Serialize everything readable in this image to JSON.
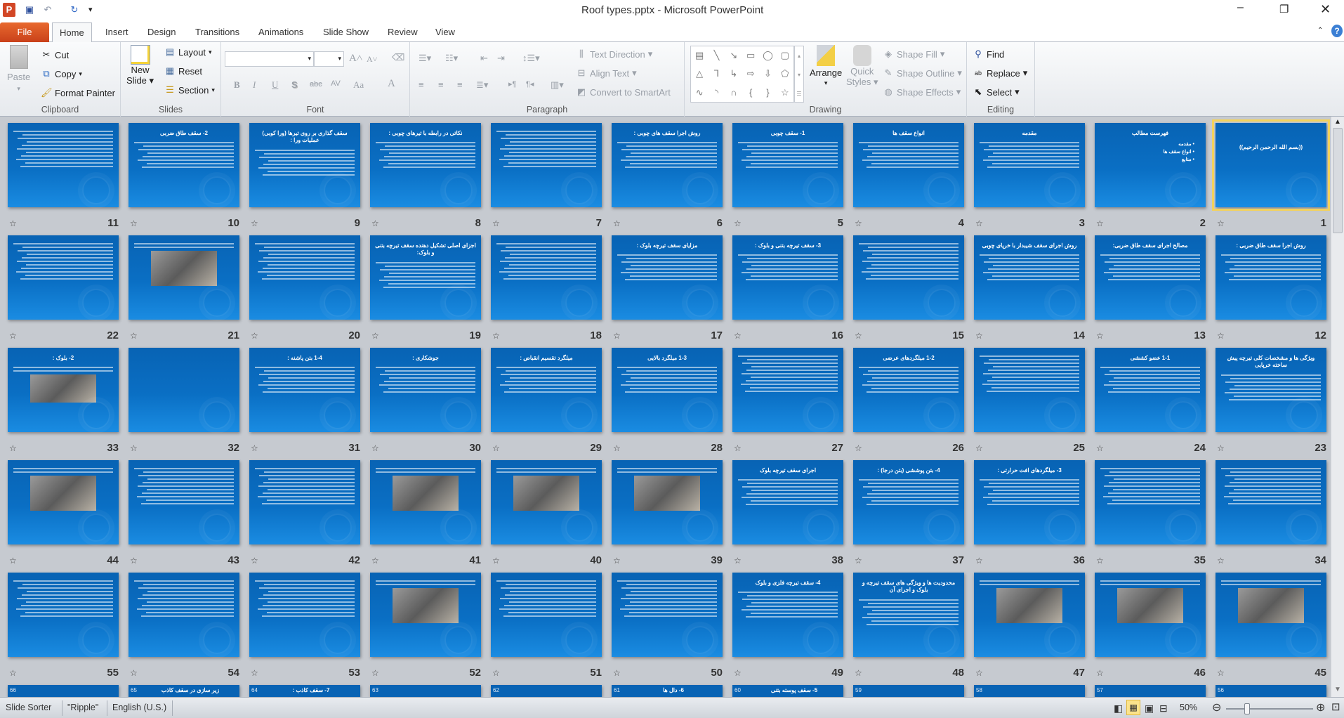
{
  "window": {
    "title": "Roof types.pptx  -  Microsoft PowerPoint",
    "app_icon": "powerpoint-icon"
  },
  "quick_access": {
    "save": "save-icon",
    "undo": "undo-icon",
    "repeat": "repeat-icon",
    "customize": "▾"
  },
  "tabs": [
    {
      "label": "File"
    },
    {
      "label": "Home",
      "active": true
    },
    {
      "label": "Insert"
    },
    {
      "label": "Design"
    },
    {
      "label": "Transitions"
    },
    {
      "label": "Animations"
    },
    {
      "label": "Slide Show"
    },
    {
      "label": "Review"
    },
    {
      "label": "View"
    }
  ],
  "ribbon": {
    "clipboard": {
      "label": "Clipboard",
      "paste": "Paste",
      "cut": "Cut",
      "copy": "Copy",
      "format_painter": "Format Painter"
    },
    "slides": {
      "label": "Slides",
      "new_slide_1": "New",
      "new_slide_2": "Slide",
      "layout": "Layout",
      "reset": "Reset",
      "section": "Section"
    },
    "font": {
      "label": "Font",
      "font_name": "",
      "font_size": "",
      "bold": "B",
      "italic": "I",
      "underline": "U",
      "shadow": "S",
      "strike": "abc",
      "spacing": "AV",
      "case": "Aa",
      "color": "A",
      "grow": "A˄",
      "shrink": "A˅"
    },
    "paragraph": {
      "label": "Paragraph",
      "text_direction": "Text Direction",
      "align_text": "Align Text",
      "smartart": "Convert to SmartArt"
    },
    "drawing": {
      "label": "Drawing",
      "arrange": "Arrange",
      "quick_1": "Quick",
      "quick_2": "Styles",
      "shape_fill": "Shape Fill",
      "shape_outline": "Shape Outline",
      "shape_effects": "Shape Effects",
      "shapes": [
        "▤",
        "╲",
        "↘",
        "▭",
        "◯",
        "▢",
        "△",
        "⅂",
        "↳",
        "⇨",
        "⇩",
        "⬠",
        "∿",
        "◝",
        "∩",
        "{",
        "}",
        "☆"
      ]
    },
    "editing": {
      "label": "Editing",
      "find": "Find",
      "replace": "Replace",
      "select": "Select"
    }
  },
  "slides": [
    {
      "n": "1",
      "title": "((بسم الله الرحمن الرحیم))",
      "kind": "title",
      "selected": true
    },
    {
      "n": "2",
      "title": "فهرست مطالب",
      "kind": "list",
      "items": [
        "مقدمه",
        "انواع سقف ها",
        "منابع"
      ]
    },
    {
      "n": "3",
      "title": "مقدمه",
      "kind": "text"
    },
    {
      "n": "4",
      "title": "انواع سقف ها",
      "kind": "text"
    },
    {
      "n": "5",
      "title": "1- سقف چوبی",
      "kind": "text"
    },
    {
      "n": "6",
      "title": "روش اجرا سقف های چوبی :",
      "kind": "text"
    },
    {
      "n": "7",
      "title": "",
      "kind": "text"
    },
    {
      "n": "8",
      "title": "نکاتی در رابطه با تیرهای چوبی :",
      "kind": "text"
    },
    {
      "n": "9",
      "title": "سقف گذاری بر روی تیرها (ورا کوبی) عملیات ورا :",
      "kind": "text"
    },
    {
      "n": "10",
      "title": "2- سقف طاق ضربی",
      "kind": "text"
    },
    {
      "n": "11",
      "title": "",
      "kind": "text"
    },
    {
      "n": "12",
      "title": "روش اجرا سقف طاق ضربی :",
      "kind": "text"
    },
    {
      "n": "13",
      "title": "مصالح اجرای سقف طاق ضربی:",
      "kind": "text"
    },
    {
      "n": "14",
      "title": "روش اجرای سقف شیبدار با خرپای چوبی",
      "kind": "text"
    },
    {
      "n": "15",
      "title": "",
      "kind": "text"
    },
    {
      "n": "16",
      "title": "3- سقف تیرچه بتنی و بلوک :",
      "kind": "text"
    },
    {
      "n": "17",
      "title": "مزایای سقف تیرچه بلوک :",
      "kind": "text"
    },
    {
      "n": "18",
      "title": "",
      "kind": "text"
    },
    {
      "n": "19",
      "title": "اجزای اصلی تشکیل دهنده سقف تیرچه بتنی و بلوک:",
      "kind": "text"
    },
    {
      "n": "20",
      "title": "",
      "kind": "text"
    },
    {
      "n": "21",
      "title": "",
      "kind": "image"
    },
    {
      "n": "22",
      "title": "",
      "kind": "text"
    },
    {
      "n": "23",
      "title": "ویژگی ها و مشخصات کلی تیرچه پیش ساخته خرپایی",
      "kind": "text"
    },
    {
      "n": "24",
      "title": "1-1  عضو کششی",
      "kind": "text"
    },
    {
      "n": "25",
      "title": "",
      "kind": "text"
    },
    {
      "n": "26",
      "title": "1-2  میلگردهای عرضی",
      "kind": "text"
    },
    {
      "n": "27",
      "title": "",
      "kind": "text"
    },
    {
      "n": "28",
      "title": "1-3  میلگرد بالایی",
      "kind": "text"
    },
    {
      "n": "29",
      "title": "میلگرد تقسیم انقباض :",
      "kind": "text"
    },
    {
      "n": "30",
      "title": "جوشکاری :",
      "kind": "text"
    },
    {
      "n": "31",
      "title": "1-4  بتن پاشنه :",
      "kind": "text"
    },
    {
      "n": "32",
      "title": "",
      "kind": "blank"
    },
    {
      "n": "33",
      "title": "2- بلوک :",
      "kind": "image"
    },
    {
      "n": "34",
      "title": "",
      "kind": "text"
    },
    {
      "n": "35",
      "title": "",
      "kind": "text"
    },
    {
      "n": "36",
      "title": "3- میلگردهای افت حرارتی :",
      "kind": "text"
    },
    {
      "n": "37",
      "title": "4- بتن پوششی (بتن درجا) :",
      "kind": "text"
    },
    {
      "n": "38",
      "title": "اجرای سقف تیرچه بلوک",
      "kind": "text"
    },
    {
      "n": "39",
      "title": "",
      "kind": "image"
    },
    {
      "n": "40",
      "title": "",
      "kind": "image"
    },
    {
      "n": "41",
      "title": "",
      "kind": "image"
    },
    {
      "n": "42",
      "title": "",
      "kind": "text"
    },
    {
      "n": "43",
      "title": "",
      "kind": "text"
    },
    {
      "n": "44",
      "title": "",
      "kind": "image"
    },
    {
      "n": "45",
      "title": "",
      "kind": "image"
    },
    {
      "n": "46",
      "title": "",
      "kind": "image"
    },
    {
      "n": "47",
      "title": "",
      "kind": "image"
    },
    {
      "n": "48",
      "title": "محدودیت ها و ویژگی های سقف تیرچه و بلوک و اجرای آن",
      "kind": "text"
    },
    {
      "n": "49",
      "title": "4- سقف تیرچه فلزی و بلوک",
      "kind": "text"
    },
    {
      "n": "50",
      "title": "",
      "kind": "text"
    },
    {
      "n": "51",
      "title": "",
      "kind": "text"
    },
    {
      "n": "52",
      "title": "",
      "kind": "image"
    },
    {
      "n": "53",
      "title": "",
      "kind": "text"
    },
    {
      "n": "54",
      "title": "",
      "kind": "text"
    },
    {
      "n": "55",
      "title": "",
      "kind": "text"
    },
    {
      "n": "56",
      "title": "",
      "kind": "text"
    },
    {
      "n": "57",
      "title": "",
      "kind": "blank"
    },
    {
      "n": "58",
      "title": "",
      "kind": "text"
    },
    {
      "n": "59",
      "title": "",
      "kind": "text"
    },
    {
      "n": "60",
      "title": "5- سقف پوسته بتنی",
      "kind": "text"
    },
    {
      "n": "61",
      "title": "6- دال ها",
      "kind": "text"
    },
    {
      "n": "62",
      "title": "",
      "kind": "text"
    },
    {
      "n": "63",
      "title": "",
      "kind": "text"
    },
    {
      "n": "64",
      "title": "7- سقف کاذب :",
      "kind": "text"
    },
    {
      "n": "65",
      "title": "زیر سازی در سقف کاذب",
      "kind": "image"
    },
    {
      "n": "66",
      "title": "",
      "kind": "text"
    }
  ],
  "status": {
    "view": "Slide Sorter",
    "theme": "\"Ripple\"",
    "language": "English (U.S.)",
    "zoom": "50%",
    "zoom_percent": 50
  },
  "colors": {
    "file_tab": "#d9531e",
    "slide_bg": "#0a6fc4",
    "selection": "#f4d25a"
  }
}
